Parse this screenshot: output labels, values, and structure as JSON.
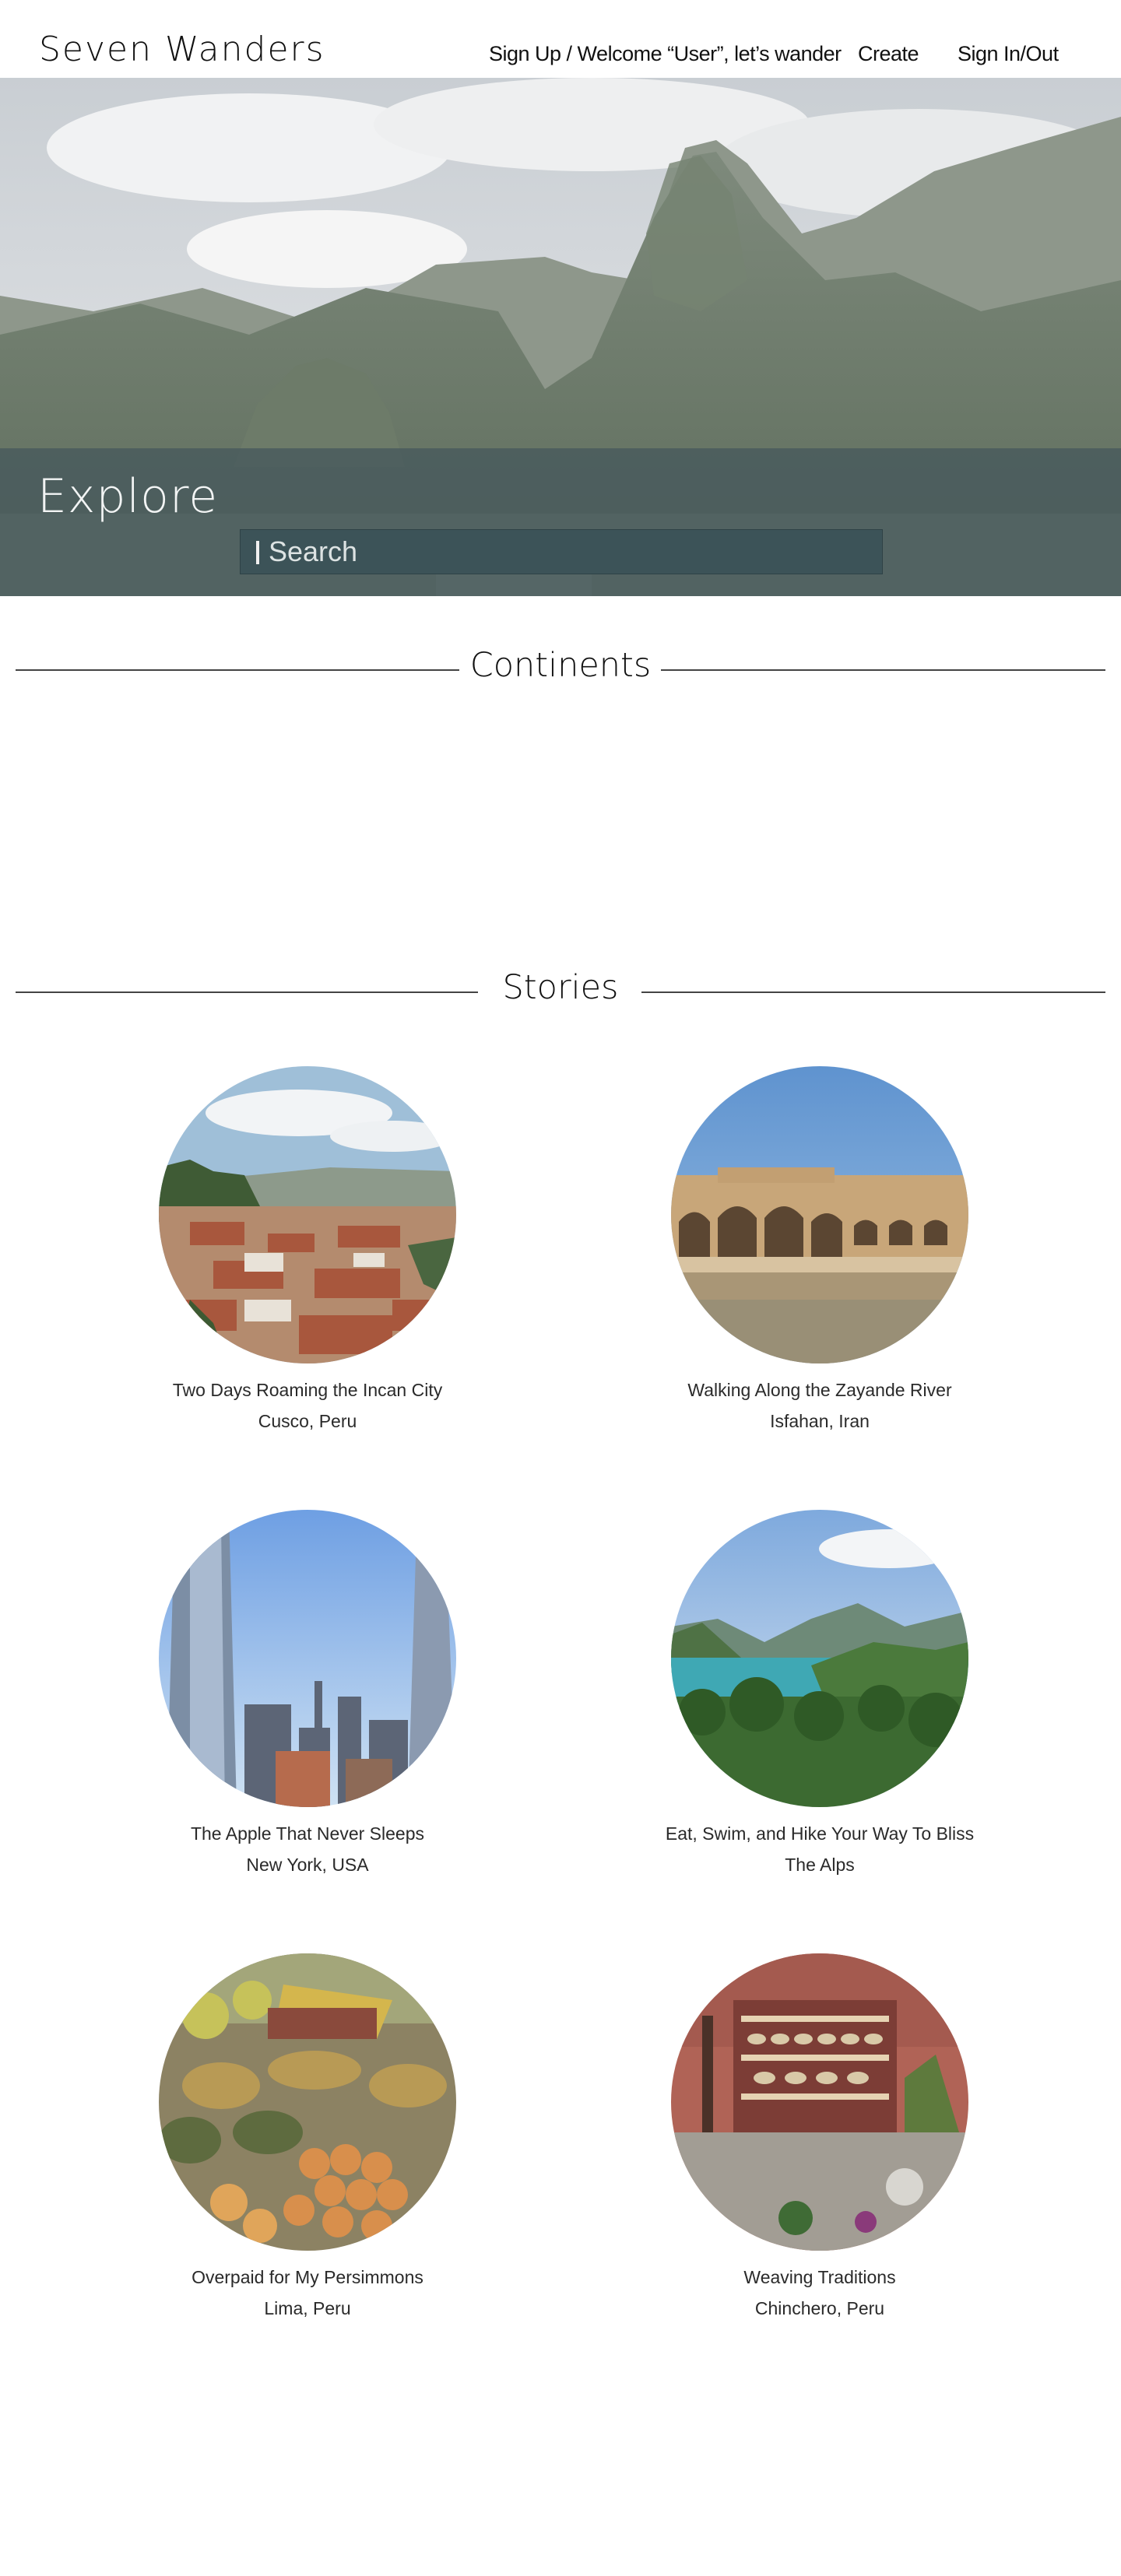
{
  "header": {
    "logo": "Seven  Wanders",
    "nav": {
      "signup": "Sign Up / Welcome “User”, let’s wander",
      "create": "Create",
      "signin": "Sign In/Out"
    }
  },
  "hero": {
    "explore_label": "Explore",
    "search_placeholder": "Search"
  },
  "sections": {
    "continents": "Continents",
    "stories": "Stories"
  },
  "stories": [
    {
      "title": "Two Days Roaming the Incan City",
      "place": "Cusco, Peru"
    },
    {
      "title": "Walking Along the Zayande River",
      "place": "Isfahan, Iran"
    },
    {
      "title": "The Apple That Never Sleeps",
      "place": "New York, USA"
    },
    {
      "title": "Eat, Swim, and Hike Your Way To Bliss",
      "place": "The Alps"
    },
    {
      "title": "Overpaid for My Persimmons",
      "place": "Lima, Peru"
    },
    {
      "title": "Weaving Traditions",
      "place": "Chinchero, Peru"
    }
  ]
}
